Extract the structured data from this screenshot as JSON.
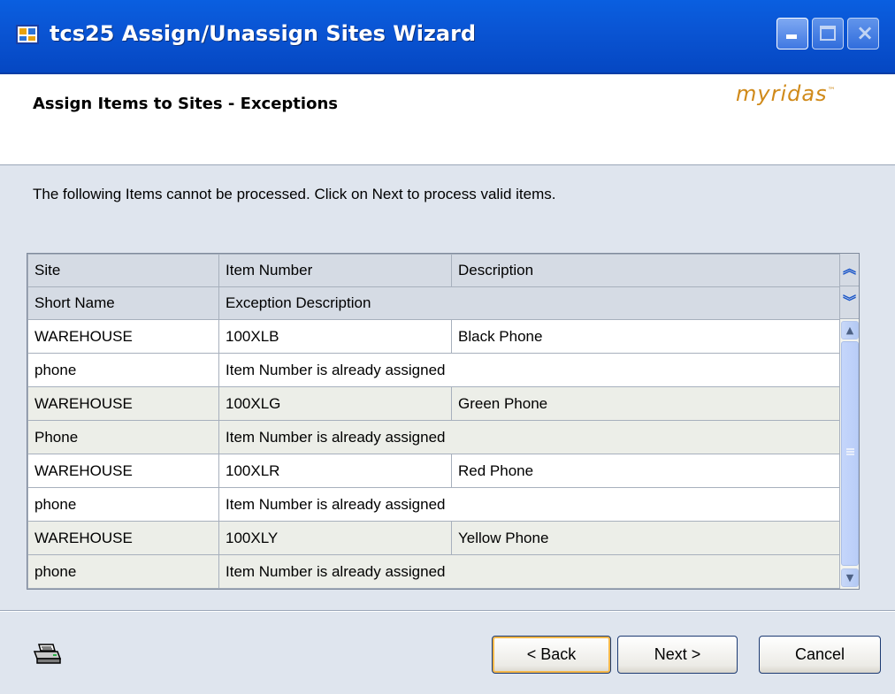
{
  "window": {
    "title": "tcs25 Assign/Unassign Sites Wizard",
    "controls": {
      "minimize": "minimize",
      "maximize": "maximize",
      "close": "×"
    }
  },
  "header": {
    "title": "Assign Items to Sites - Exceptions",
    "logo": "myridas",
    "logo_tm": "™"
  },
  "instruction": "The following Items cannot be processed. Click on Next to process valid items.",
  "grid": {
    "header_row1": [
      "Site",
      "Item Number",
      "Description"
    ],
    "header_row2": [
      "Short Name",
      "Exception Description"
    ],
    "expand_icon": "«",
    "collapse_icon": "»",
    "records": [
      {
        "site": "WAREHOUSE",
        "item": "100XLB",
        "description": "Black Phone",
        "short_name": "phone",
        "exception": "Item Number is already assigned"
      },
      {
        "site": "WAREHOUSE",
        "item": "100XLG",
        "description": "Green Phone",
        "short_name": "Phone",
        "exception": "Item Number is already assigned"
      },
      {
        "site": "WAREHOUSE",
        "item": "100XLR",
        "description": "Red Phone",
        "short_name": "phone",
        "exception": "Item Number is already assigned"
      },
      {
        "site": "WAREHOUSE",
        "item": "100XLY",
        "description": "Yellow Phone",
        "short_name": "phone",
        "exception": "Item Number is already assigned"
      }
    ]
  },
  "footer": {
    "print_icon": "printer-icon",
    "back_label": "< Back",
    "next_label": "Next >",
    "cancel_label": "Cancel"
  }
}
